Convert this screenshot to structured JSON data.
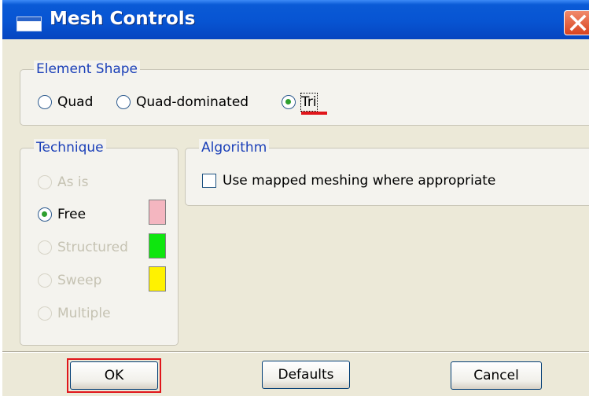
{
  "window": {
    "title": "Mesh Controls"
  },
  "element_shape": {
    "legend": "Element Shape",
    "options": [
      {
        "label": "Quad",
        "checked": false
      },
      {
        "label": "Quad-dominated",
        "checked": false
      },
      {
        "label": "Tri",
        "checked": true
      }
    ]
  },
  "technique": {
    "legend": "Technique",
    "options": [
      {
        "label": "As is",
        "checked": false,
        "enabled": false,
        "swatch": null
      },
      {
        "label": "Free",
        "checked": true,
        "enabled": true,
        "swatch": "#f4b6c0"
      },
      {
        "label": "Structured",
        "checked": false,
        "enabled": false,
        "swatch": "#0ee60e"
      },
      {
        "label": "Sweep",
        "checked": false,
        "enabled": false,
        "swatch": "#fff200"
      },
      {
        "label": "Multiple",
        "checked": false,
        "enabled": false,
        "swatch": null
      }
    ]
  },
  "algorithm": {
    "legend": "Algorithm",
    "mapped_meshing_label": "Use mapped meshing where appropriate",
    "mapped_meshing_checked": false
  },
  "buttons": {
    "ok": "OK",
    "defaults": "Defaults",
    "cancel": "Cancel"
  },
  "colors": {
    "titlebar": "#0754d2",
    "legend_text": "#1a3fb8",
    "highlight": "#e0151a"
  }
}
